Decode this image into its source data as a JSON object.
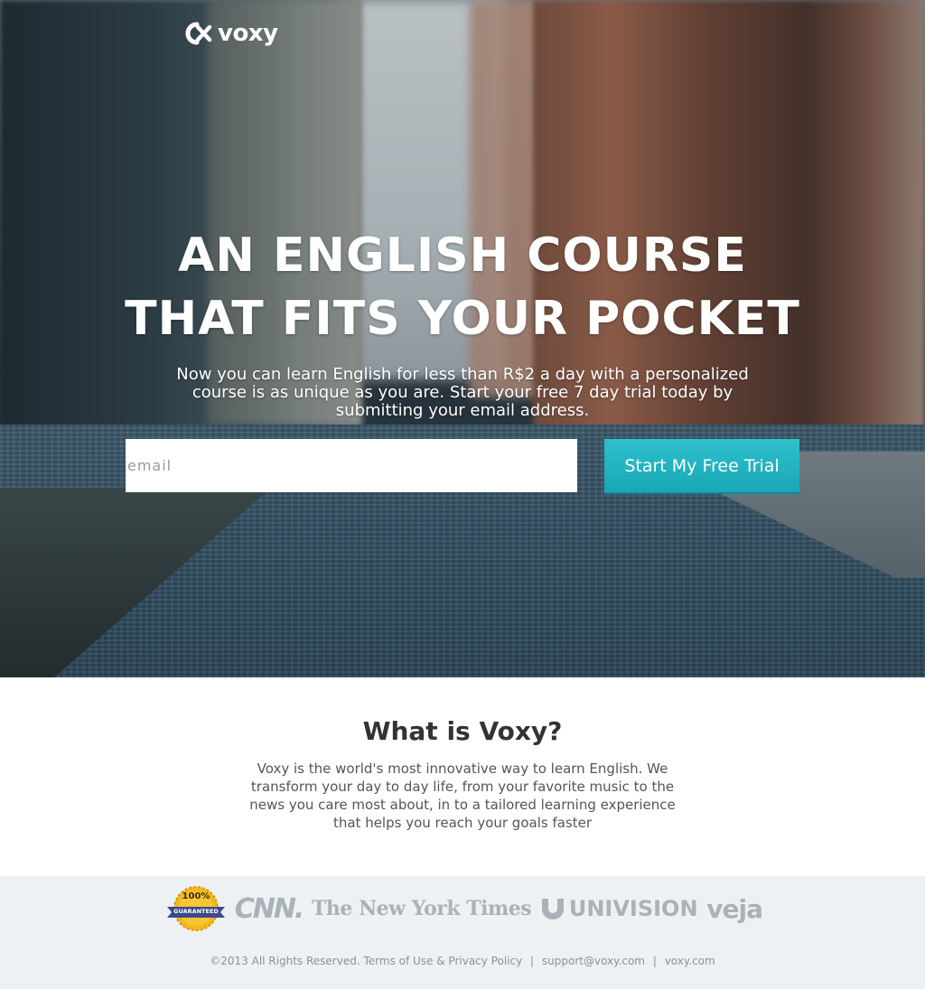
{
  "brand": {
    "logo_text": "voxy"
  },
  "hero": {
    "headline_line1": "AN ENGLISH COURSE",
    "headline_line2": "THAT FITS YOUR POCKET",
    "subcopy": "Now you can learn English for less than R$2 a day with a personalized course is as unique as you are. Start your free 7 day trial today by submitting your email address.",
    "email_placeholder": "email",
    "cta_label": "Start My Free Trial"
  },
  "about": {
    "title": "What is Voxy?",
    "body": "Voxy is the world's most innovative way to learn English. We transform your day to day life, from your favorite music to the news you care most about, in to a tailored learning experience that helps you reach your goals faster"
  },
  "press": {
    "badge_top": "100%",
    "badge_bottom": "GUARANTEED",
    "logos": [
      "CNN.",
      "The New York Times",
      "UNIVISION",
      "veja"
    ]
  },
  "footer": {
    "copyright": "©2013 All Rights Reserved.",
    "terms": "Terms of Use & Privacy Policy",
    "support": "support@voxy.com",
    "site": "voxy.com",
    "separator": "|"
  },
  "colors": {
    "cta": "#1fb2c0",
    "press_bg": "#eef1f3",
    "press_logo": "#a9b2b8",
    "badge_gold": "#f2b81c",
    "badge_ribbon": "#3b4a8a"
  },
  "icons": {
    "logo_mark": "voxy-logo-icon",
    "univision_mark": "univision-logo-icon"
  }
}
